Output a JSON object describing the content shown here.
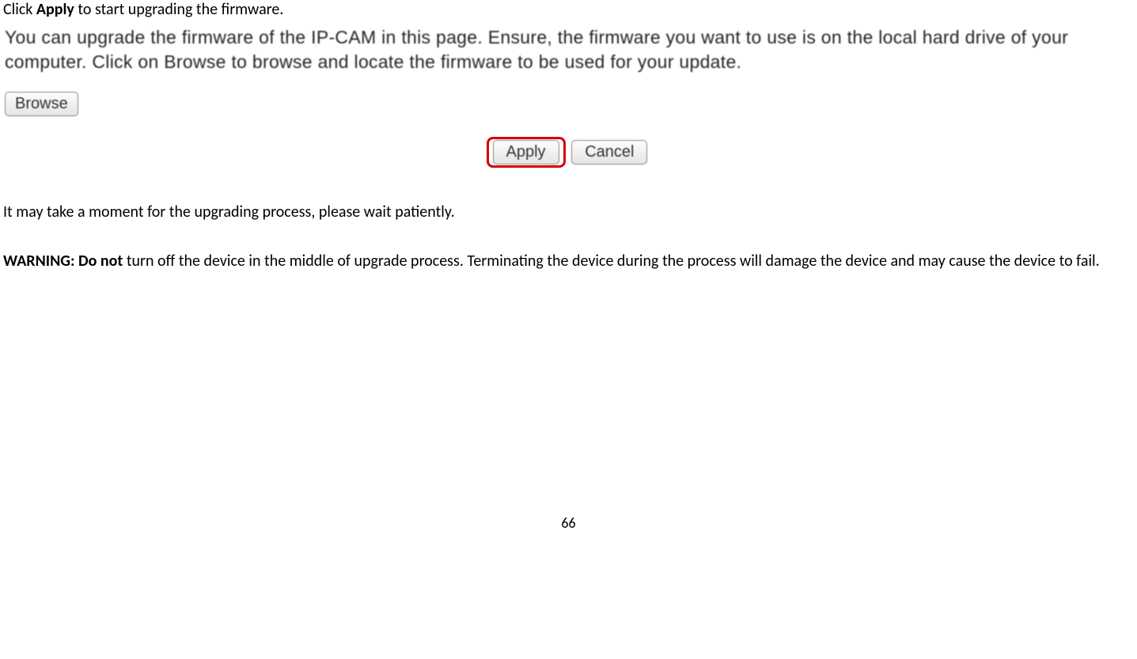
{
  "intro": {
    "click_text": "Click ",
    "apply_word": "Apply",
    "after_apply": " to start upgrading the firmware."
  },
  "panel": {
    "description": "You can upgrade the firmware of the IP-CAM in this page. Ensure, the firmware you want to use is on the local hard drive of your computer. Click on Browse to browse and locate the firmware to be used for your update.",
    "browse_label": "Browse",
    "apply_label": "Apply",
    "cancel_label": "Cancel"
  },
  "body": {
    "wait_text": "It may take a moment for the upgrading process, please wait patiently.",
    "warning_prefix": "WARNING: Do not",
    "warning_rest": " turn off the device in the middle of upgrade process. Terminating the device during the process will damage the device and may cause the device to fail."
  },
  "page_number": "66"
}
